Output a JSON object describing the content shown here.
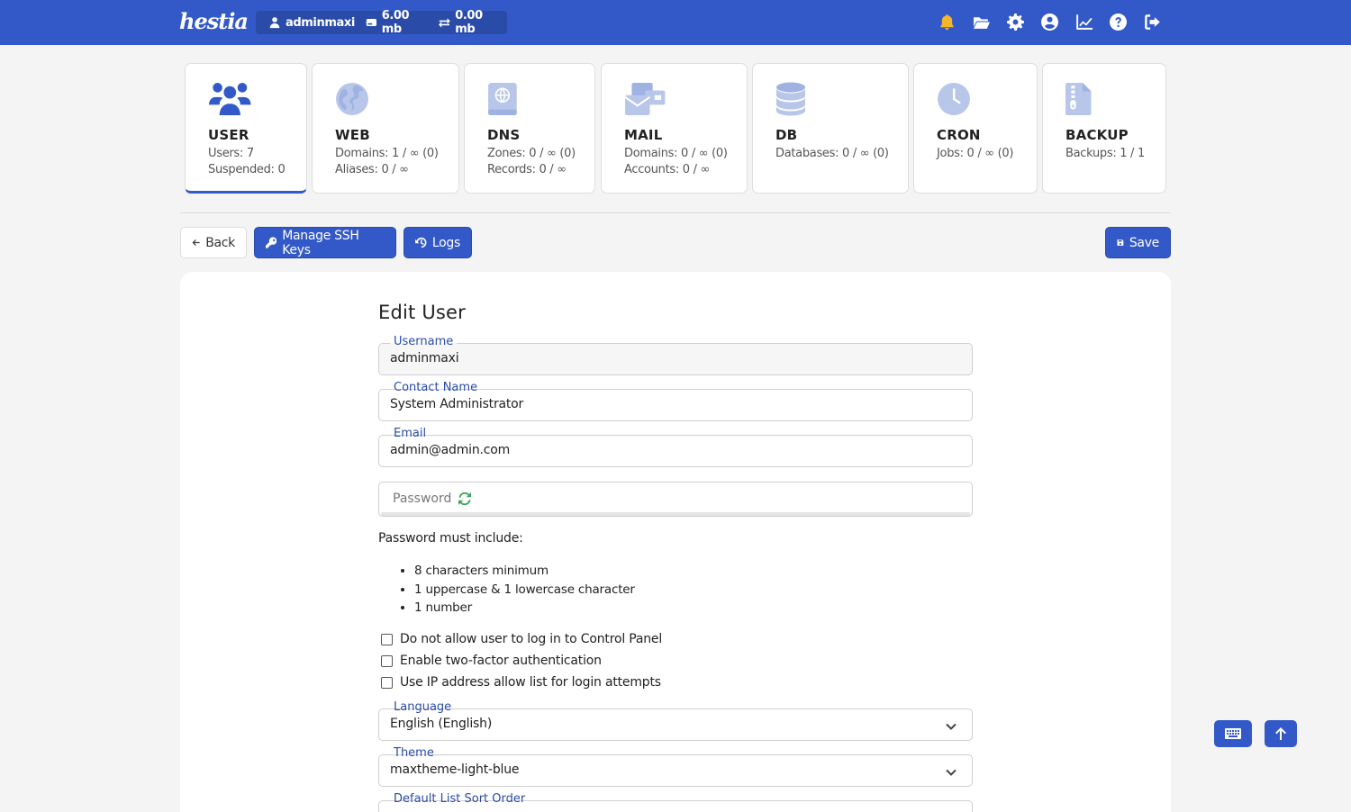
{
  "app": {
    "logo_text": "hestia"
  },
  "header": {
    "user": "adminmaxi",
    "disk": "6.00 mb",
    "bandwidth": "0.00 mb",
    "icons": [
      "bell-icon",
      "folder-icon",
      "gear-icon",
      "user-circle-icon",
      "chart-line-icon",
      "help-icon",
      "logout-icon"
    ],
    "bell_color": "#f5b529",
    "bar_color": "#3259c7"
  },
  "stats": [
    {
      "title": "USER",
      "lines": [
        "Users: 7",
        "Suspended: 0"
      ],
      "icon": "users-icon"
    },
    {
      "title": "WEB",
      "lines": [
        "Domains: 1 / ∞ (0)",
        "Aliases: 0 / ∞"
      ],
      "icon": "globe-icon"
    },
    {
      "title": "DNS",
      "lines": [
        "Zones: 0 / ∞ (0)",
        "Records: 0 / ∞"
      ],
      "icon": "address-book-icon"
    },
    {
      "title": "MAIL",
      "lines": [
        "Domains: 0 / ∞ (0)",
        "Accounts: 0 / ∞"
      ],
      "icon": "mail-bulk-icon"
    },
    {
      "title": "DB",
      "lines": [
        "Databases: 0 / ∞ (0)"
      ],
      "icon": "database-icon"
    },
    {
      "title": "CRON",
      "lines": [
        "Jobs: 0 / ∞ (0)"
      ],
      "icon": "clock-icon"
    },
    {
      "title": "BACKUP",
      "lines": [
        "Backups: 1 / 1"
      ],
      "icon": "file-zipper-icon"
    }
  ],
  "toolbar": {
    "back": "Back",
    "ssh_keys": "Manage SSH Keys",
    "logs": "Logs",
    "save": "Save"
  },
  "form": {
    "title": "Edit User",
    "username_label": "Username",
    "username": "adminmaxi",
    "contact_label": "Contact Name",
    "contact": "System Administrator",
    "email_label": "Email",
    "email": "admin@admin.com",
    "password_placeholder": "Password",
    "password_hint": "Password must include:",
    "password_rules": [
      "8 characters minimum",
      "1 uppercase & 1 lowercase character",
      "1 number"
    ],
    "checkboxes": [
      "Do not allow user to log in to Control Panel",
      "Enable two-factor authentication",
      "Use IP address allow list for login attempts"
    ],
    "language_label": "Language",
    "language": "English (English)",
    "theme_label": "Theme",
    "theme": "maxtheme-light-blue",
    "sort_label": "Default List Sort Order"
  }
}
